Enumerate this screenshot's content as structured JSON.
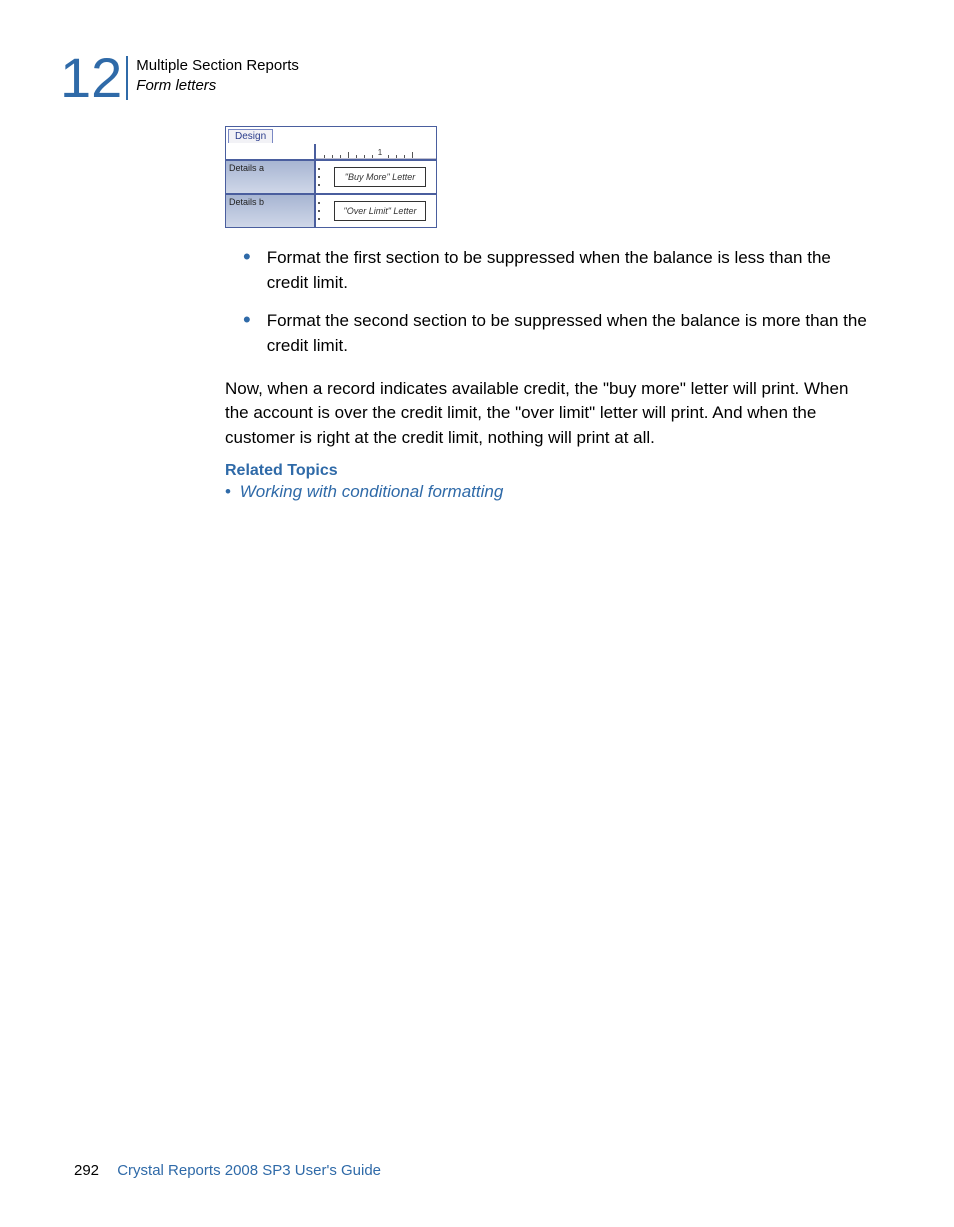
{
  "header": {
    "chapter_number": "12",
    "title_line1": "Multiple Section Reports",
    "title_line2": "Form letters"
  },
  "figure": {
    "tab_label": "Design",
    "ruler_number": "1",
    "rows": [
      {
        "label": "Details a",
        "box": "\"Buy More\" Letter"
      },
      {
        "label": "Details b",
        "box": "\"Over Limit\" Letter"
      }
    ]
  },
  "bullets": {
    "b1": "Format the first section to be suppressed when the balance is less than the credit limit.",
    "b2": "Format the second section to be suppressed when the balance is more than the credit limit."
  },
  "para": "Now, when a record indicates available credit, the \"buy more\" letter will print. When the account is over the credit limit, the \"over limit\" letter will print. And when the customer is right at the credit limit, nothing will print at all.",
  "related": {
    "heading": "Related Topics",
    "link": "Working with conditional formatting"
  },
  "footer": {
    "page_number": "292",
    "guide_title": "Crystal Reports 2008 SP3 User's Guide"
  }
}
